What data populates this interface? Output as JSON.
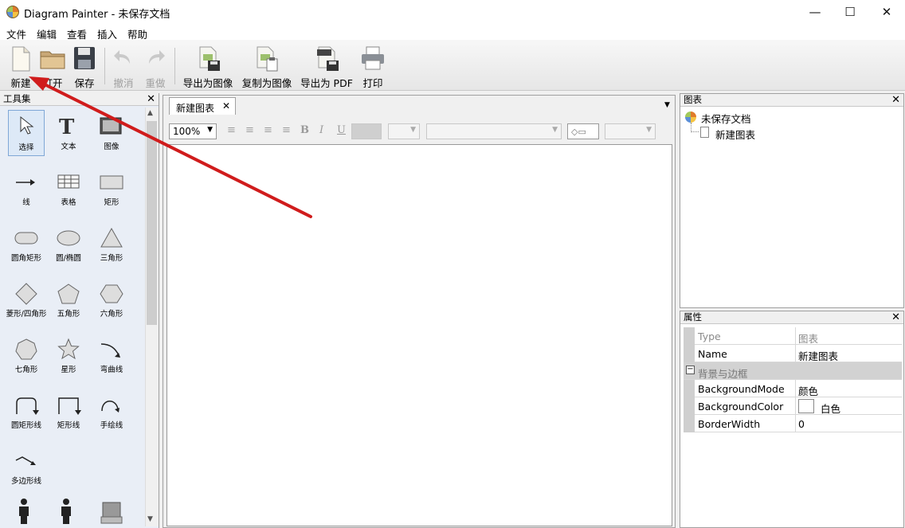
{
  "window": {
    "app_name": "Diagram Painter",
    "title": "Diagram Painter - 未保存文档",
    "minimize": "—",
    "maximize": "☐",
    "close": "✕"
  },
  "menu": [
    "文件",
    "编辑",
    "查看",
    "插入",
    "帮助"
  ],
  "toolbar": {
    "new": "新建",
    "open": "打开",
    "save": "保存",
    "undo": "撤消",
    "redo": "重做",
    "export_image": "导出为图像",
    "copy_image": "复制为图像",
    "export_pdf": "导出为 PDF",
    "print": "打印"
  },
  "toolbox": {
    "title": "工具集",
    "tools": [
      "选择",
      "文本",
      "图像",
      "线",
      "表格",
      "矩形",
      "圆角矩形",
      "圆/椭圆",
      "三角形",
      "菱形/四角形",
      "五角形",
      "六角形",
      "七角形",
      "星形",
      "弯曲线",
      "圆矩形线",
      "矩形线",
      "手绘线",
      "多边形线"
    ]
  },
  "document": {
    "tab": "新建图表",
    "zoom": "100%"
  },
  "chart_panel": {
    "title": "图表",
    "root": "未保存文档",
    "child": "新建图表"
  },
  "prop_panel": {
    "title": "属性",
    "group": "背景与边框",
    "rows": [
      {
        "key": "Type",
        "value": "图表"
      },
      {
        "key": "Name",
        "value": "新建图表"
      },
      {
        "key": "BackgroundMode",
        "value": "颜色"
      },
      {
        "key": "BackgroundColor",
        "value": "白色"
      },
      {
        "key": "BorderWidth",
        "value": "0"
      }
    ]
  },
  "icons": {
    "accent_arrow": "#d01c1c"
  }
}
